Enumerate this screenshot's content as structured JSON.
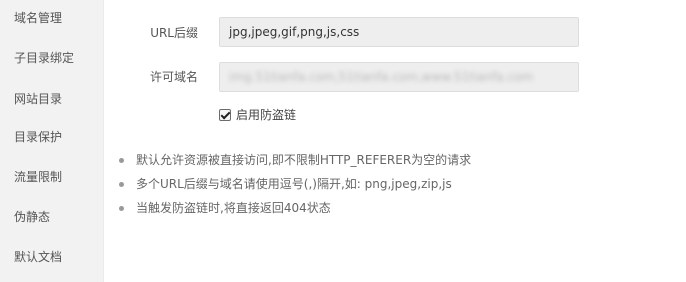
{
  "sidebar": {
    "items": [
      {
        "label": "域名管理"
      },
      {
        "label": "子目录绑定"
      },
      {
        "label": "网站目录"
      },
      {
        "label": "目录保护"
      },
      {
        "label": "流量限制"
      },
      {
        "label": "伪静态"
      },
      {
        "label": "默认文档"
      }
    ]
  },
  "form": {
    "url_suffix": {
      "label": "URL后缀",
      "value": "jpg,jpeg,gif,png,js,css"
    },
    "allowed_domains": {
      "label": "许可域名",
      "value": "img.51tianfa.com,51tianfa.com,www.51tianfa.com"
    },
    "enable": {
      "label": "启用防盗链",
      "checked": true
    }
  },
  "tips": [
    "默认允许资源被直接访问,即不限制HTTP_REFERER为空的请求",
    "多个URL后缀与域名请使用逗号(,)隔开,如: png,jpeg,zip,js",
    "当触发防盗链时,将直接返回404状态"
  ]
}
